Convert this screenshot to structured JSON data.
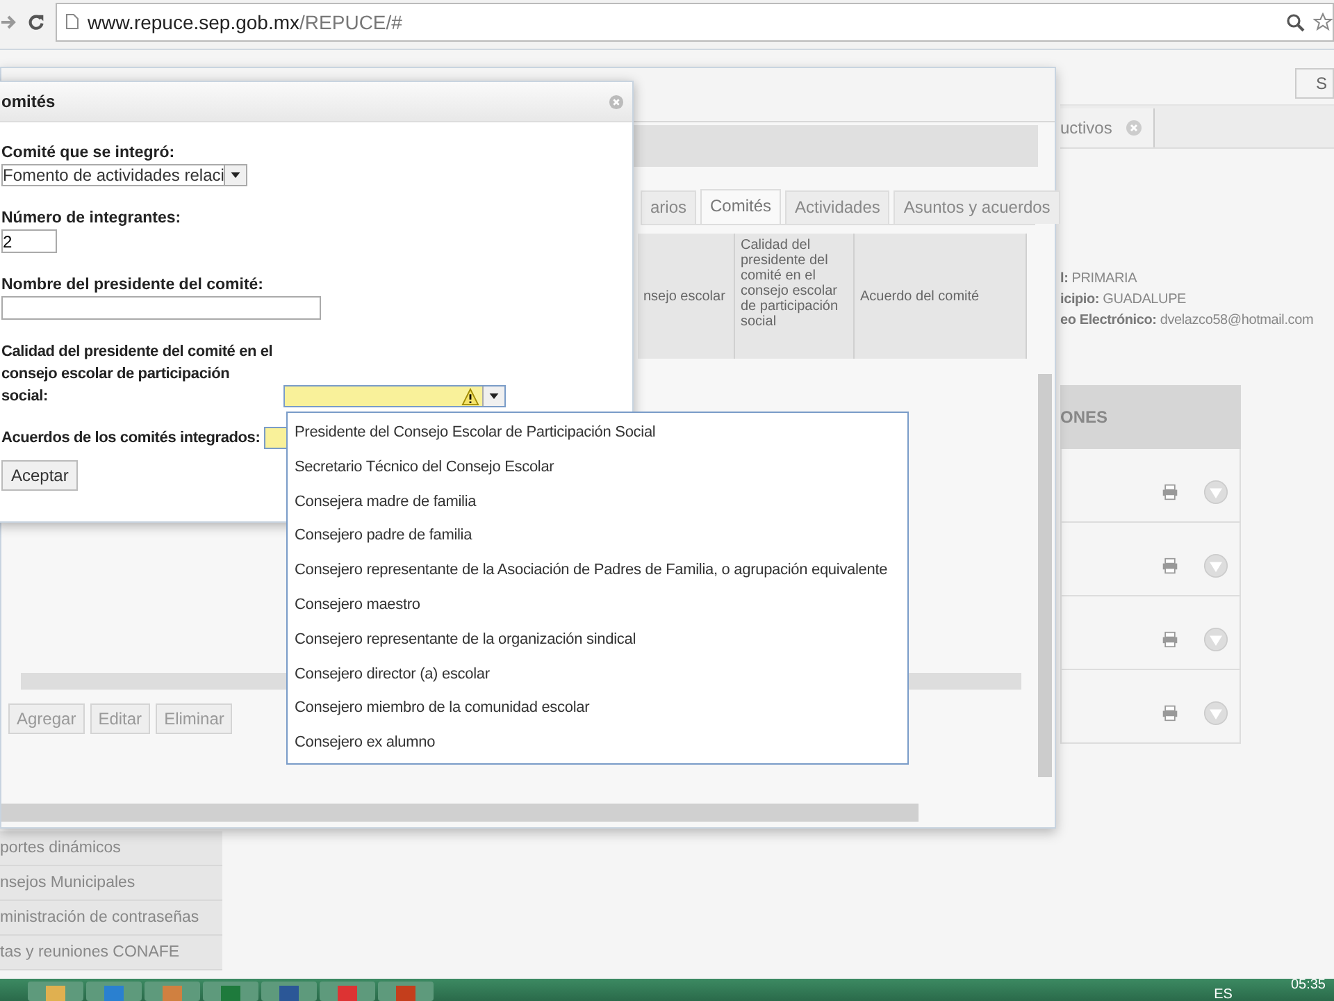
{
  "browser": {
    "url_host": "www.repuce.sep.gob.mx",
    "url_path": "/REPUCE/#"
  },
  "header_button": {
    "label": "S"
  },
  "page_tab": {
    "label": "uctivos"
  },
  "school_info": [
    {
      "label": "l:",
      "value": "PRIMARIA"
    },
    {
      "label": "icipio:",
      "value": "GUADALUPE"
    },
    {
      "label": "eo Electrónico:",
      "value": "dvelazco58@hotmail.com"
    }
  ],
  "actions_table": {
    "header": "ONES",
    "rows": [
      {
        "kind": "actions"
      },
      {
        "kind": "actions"
      },
      {
        "kind": "actions"
      },
      {
        "kind": "actions"
      }
    ]
  },
  "sidebar": {
    "items": [
      "portes dinámicos",
      "nsejos Municipales",
      "ministración de contraseñas",
      "tas y reuniones CONAFE"
    ]
  },
  "window": {
    "tabs": [
      {
        "label": "arios",
        "selected": false
      },
      {
        "label": "Comités",
        "selected": true
      },
      {
        "label": "Actividades",
        "selected": false
      },
      {
        "label": "Asuntos y acuerdos",
        "selected": false
      }
    ],
    "columns": [
      "nsejo escolar",
      "Calidad del presidente del comité en el consejo escolar de participación social",
      "Acuerdo del comité"
    ],
    "buttons": [
      {
        "label": "Agregar",
        "disabled": true
      },
      {
        "label": "Editar",
        "disabled": true
      },
      {
        "label": "Eliminar",
        "disabled": true
      }
    ]
  },
  "dialog": {
    "title": "omités",
    "fields": [
      {
        "kind": "select",
        "label": "Comité que se integró:",
        "value": "Fomento de actividades relaci"
      },
      {
        "kind": "number",
        "label": "Número de integrantes:",
        "value": "2"
      },
      {
        "kind": "text",
        "label": "Nombre del presidente del comité:"
      },
      {
        "kind": "select",
        "label": "Calidad del presidente del comité en el consejo escolar de participación social:",
        "invalid": true,
        "inline": true,
        "warning": true
      },
      {
        "kind": "select",
        "label": "Acuerdos de los comités integrados:",
        "invalid": true,
        "inline": true
      }
    ],
    "button": "Aceptar"
  },
  "dropdown": {
    "options": [
      {
        "label": "Presidente del Consejo Escolar de Participación Social",
        "selected": false
      },
      {
        "label": "Secretario Técnico del Consejo Escolar",
        "selected": false
      },
      {
        "label": "Consejera madre de familia",
        "selected": false
      },
      {
        "label": "Consejero padre de familia",
        "selected": false
      },
      {
        "label": "Consejero representante de la Asociación de Padres de Familia, o agrupación equivalente",
        "selected": false
      },
      {
        "label": "Consejero maestro",
        "selected": false
      },
      {
        "label": "Consejero representante de la organización sindical",
        "selected": false
      },
      {
        "label": "Consejero director (a) escolar",
        "selected": false
      },
      {
        "label": "Consejero miembro de la comunidad escolar",
        "selected": false
      },
      {
        "label": "Consejero ex alumno",
        "selected": false
      }
    ]
  },
  "taskbar": {
    "language": "ES",
    "clock": "05:35"
  }
}
